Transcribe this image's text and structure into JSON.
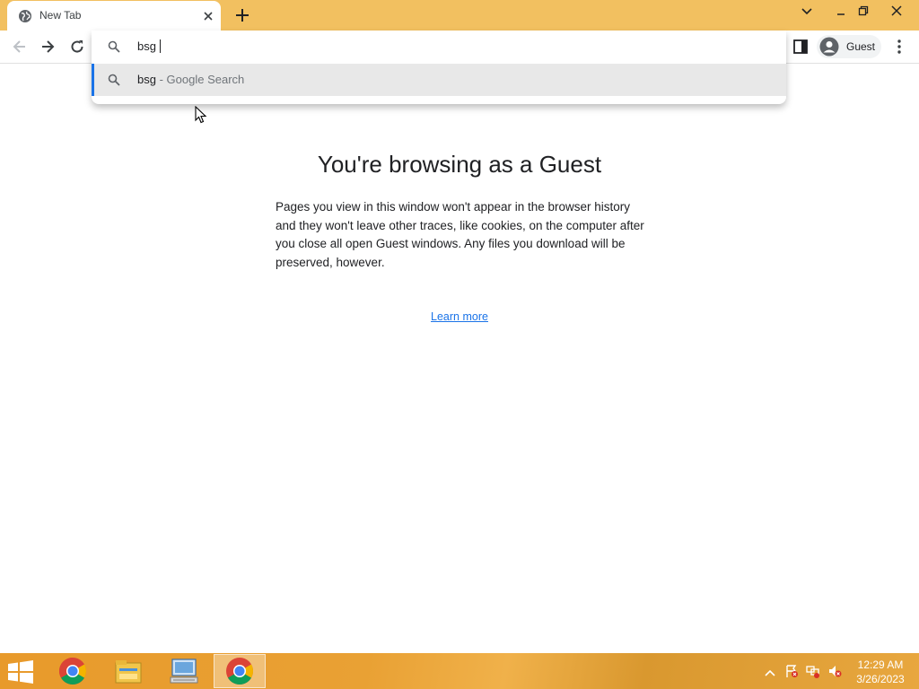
{
  "browser": {
    "tab": {
      "title": "New Tab"
    },
    "omnibox": {
      "typed_text": "bsg"
    },
    "suggestion": {
      "query": "bsg",
      "separator": " - ",
      "engine": "Google Search"
    },
    "profile": {
      "label": "Guest"
    }
  },
  "page": {
    "title": "You're browsing as a Guest",
    "body": "Pages you view in this window won't appear in the browser history and they won't leave other traces, like cookies, on the computer after you close all open Guest windows. Any files you download will be preserved, however.",
    "learn_more": "Learn more"
  },
  "taskbar": {
    "clock_time": "12:29 AM",
    "clock_date": "3/26/2023",
    "apps": [
      {
        "name": "chrome-icon"
      },
      {
        "name": "file-explorer-icon"
      },
      {
        "name": "remote-desktop-icon"
      },
      {
        "name": "chrome-icon",
        "active": true
      }
    ]
  },
  "colors": {
    "tabstrip": "#f2c060",
    "accent": "#1a73e8",
    "taskbar": "#e9a134"
  }
}
